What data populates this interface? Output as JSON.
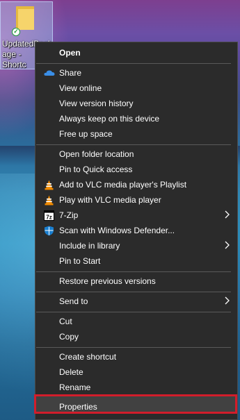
{
  "desktop": {
    "icon_label": "UpdatedBack\nage - \nShortc"
  },
  "menu": {
    "items": [
      {
        "label": "Open"
      },
      {
        "label": "Share",
        "icon": "onedrive-cloud-icon"
      },
      {
        "label": "View online"
      },
      {
        "label": "View version history"
      },
      {
        "label": "Always keep on this device"
      },
      {
        "label": "Free up space"
      },
      {
        "label": "Open folder location"
      },
      {
        "label": "Pin to Quick access"
      },
      {
        "label": "Add to VLC media player's Playlist",
        "icon": "vlc-cone-icon"
      },
      {
        "label": "Play with VLC media player",
        "icon": "vlc-cone-icon"
      },
      {
        "label": "7-Zip",
        "icon": "7zip-icon",
        "submenu": true
      },
      {
        "label": "Scan with Windows Defender...",
        "icon": "defender-shield-icon"
      },
      {
        "label": "Include in library",
        "submenu": true
      },
      {
        "label": "Pin to Start"
      },
      {
        "label": "Restore previous versions"
      },
      {
        "label": "Send to",
        "submenu": true
      },
      {
        "label": "Cut"
      },
      {
        "label": "Copy"
      },
      {
        "label": "Create shortcut"
      },
      {
        "label": "Delete"
      },
      {
        "label": "Rename"
      },
      {
        "label": "Properties",
        "highlighted": true
      }
    ]
  },
  "colors": {
    "menu_bg": "#2b2b2b",
    "highlight_outline": "#d21d2b",
    "folder": "#f6d46b",
    "vlc_orange": "#f08a00",
    "onedrive_blue": "#3a8ee6",
    "defender_blue": "#1a7fd0"
  }
}
